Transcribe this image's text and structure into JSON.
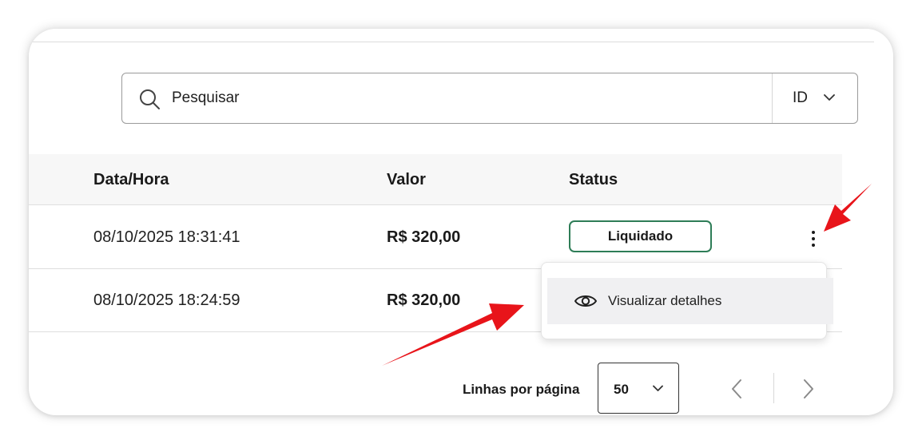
{
  "search": {
    "placeholder": "Pesquisar",
    "filter_label": "ID"
  },
  "table": {
    "columns": [
      "Data/Hora",
      "Valor",
      "Status"
    ],
    "rows": [
      {
        "datetime": "08/10/2025 18:31:41",
        "value": "R$ 320,00",
        "status": "Liquidado"
      },
      {
        "datetime": "08/10/2025 18:24:59",
        "value": "R$ 320,00"
      }
    ]
  },
  "row_menu": {
    "items": [
      {
        "label": "Visualizar detalhes",
        "icon": "eye-icon"
      }
    ]
  },
  "pagination": {
    "rows_per_page_label": "Linhas por página",
    "rows_per_page_value": "50"
  },
  "colors": {
    "status_border": "#2e7d57",
    "annotation_arrow": "#e8141a",
    "menu_highlight": "#f0f0f2"
  }
}
